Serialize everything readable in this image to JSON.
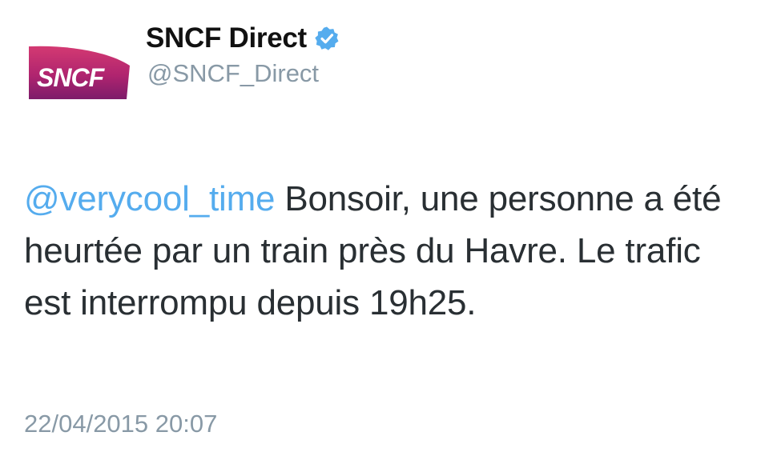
{
  "tweet": {
    "author": {
      "display_name": "SNCF Direct",
      "handle": "@SNCF_Direct",
      "verified": true,
      "avatar_logo_text": "SNCF"
    },
    "mention": "@verycool_time",
    "body": " Bonsoir, une personne a été heurtée par un train près du Havre. Le trafic est interrompu depuis 19h25.",
    "timestamp": "22/04/2015 20:07"
  },
  "colors": {
    "mention": "#55acee",
    "verified_badge": "#55acee",
    "muted_text": "#8899a6",
    "body_text": "#292f33",
    "sncf_logo_top": "#c4276f",
    "sncf_logo_bottom": "#8a1e6e"
  },
  "icons": {
    "verified": "verified-badge-icon",
    "avatar": "sncf-logo"
  }
}
